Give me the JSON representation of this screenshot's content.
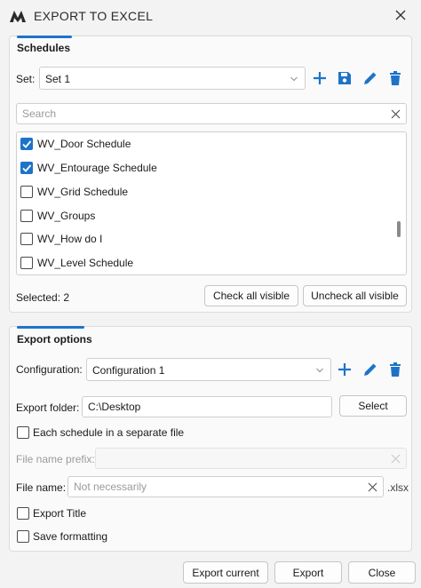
{
  "window": {
    "title": "EXPORT TO EXCEL"
  },
  "colors": {
    "accent": "#1e73c8",
    "icon_blue": "#1e73c8"
  },
  "schedules": {
    "title": "Schedules",
    "set_label": "Set:",
    "set_value": "Set 1",
    "search_placeholder": "Search",
    "items": [
      {
        "label": "WV_Door Schedule",
        "checked": true
      },
      {
        "label": "WV_Entourage Schedule",
        "checked": true
      },
      {
        "label": "WV_Grid Schedule",
        "checked": false
      },
      {
        "label": "WV_Groups",
        "checked": false
      },
      {
        "label": "WV_How do I",
        "checked": false
      },
      {
        "label": "WV_Level Schedule",
        "checked": false
      }
    ],
    "selected_text": "Selected: 2",
    "check_all": "Check all visible",
    "uncheck_all": "Uncheck all visible",
    "toolbar_icons": [
      "plus-icon",
      "save-icon",
      "pencil-icon",
      "trash-icon"
    ]
  },
  "export": {
    "title": "Export options",
    "config_label": "Configuration:",
    "config_value": "Configuration 1",
    "folder_label": "Export folder:",
    "folder_value": "C:\\Desktop",
    "select_button": "Select",
    "separate_file_label": "Each schedule in a separate file",
    "separate_file_checked": false,
    "prefix_label": "File name prefix:",
    "prefix_value": "",
    "filename_label": "File name:",
    "filename_placeholder": "Not necessarily",
    "filename_ext": ".xlsx",
    "export_title_label": "Export Title",
    "export_title_checked": false,
    "save_formatting_label": "Save formatting",
    "save_formatting_checked": false
  },
  "footer": {
    "export_current": "Export current",
    "export": "Export",
    "close": "Close"
  }
}
